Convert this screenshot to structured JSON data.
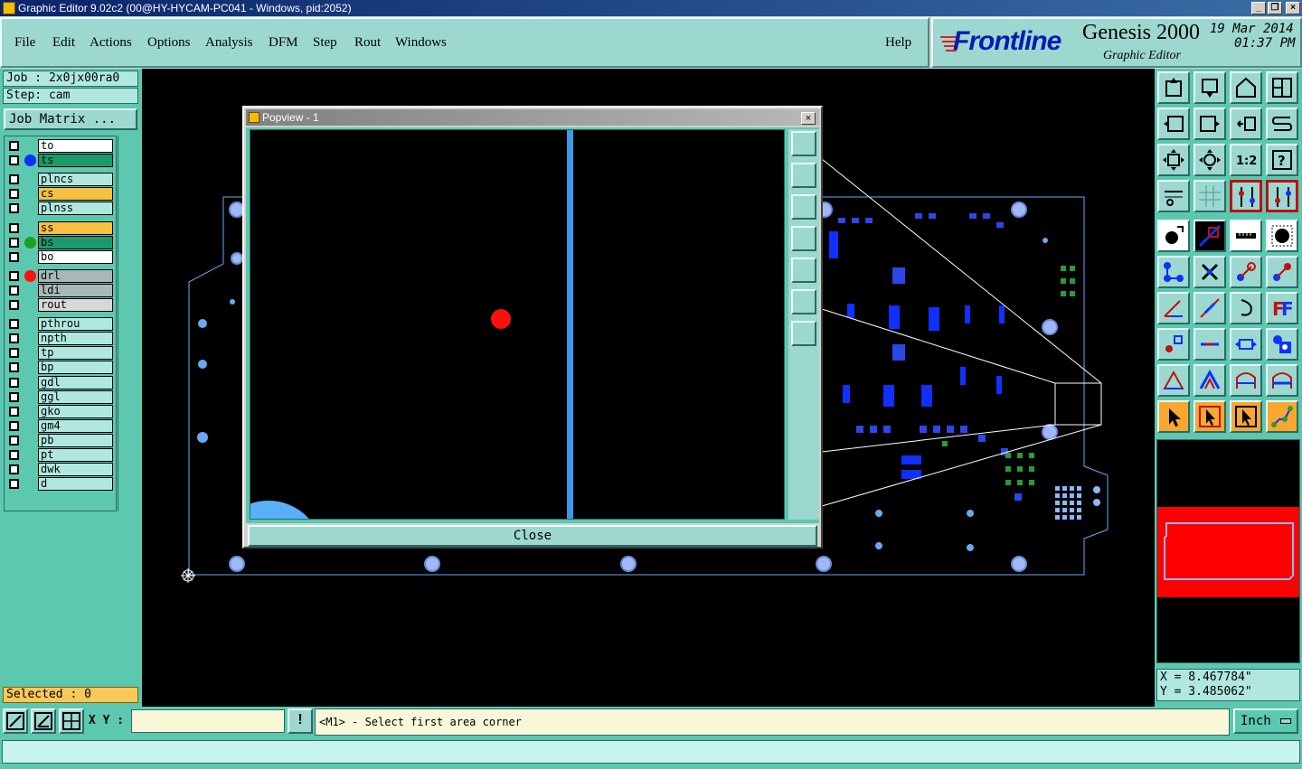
{
  "window": {
    "title": "Graphic Editor 9.02c2 (00@HY-HYCAM-PC041 - Windows, pid:2052)"
  },
  "menu": {
    "items": [
      "File",
      "Edit",
      "Actions",
      "Options",
      "Analysis",
      "DFM",
      "Step",
      "Rout",
      "Windows"
    ],
    "help": "Help"
  },
  "brand": {
    "logo": "Frontline",
    "product": "Genesis 2000",
    "subtitle": "Graphic Editor",
    "date": "19 Mar 2014",
    "time": "01:37 PM"
  },
  "job": {
    "job_line": "Job : 2x0jx00ra0",
    "step_line": "Step: cam",
    "matrix_button": "Job Matrix ..."
  },
  "layers": [
    {
      "name": "to",
      "color": "#ffffff",
      "dot": ""
    },
    {
      "name": "ts",
      "color": "#1a9a6a",
      "dot": "#1030ff"
    },
    {
      "name": "plncs",
      "color": "#b0e8e0",
      "dot": ""
    },
    {
      "name": "cs",
      "color": "#f8c040",
      "dot": ""
    },
    {
      "name": "plnss",
      "color": "#b0e8e0",
      "dot": ""
    },
    {
      "name": "ss",
      "color": "#f8c040",
      "dot": ""
    },
    {
      "name": "bs",
      "color": "#1a9a6a",
      "dot": "#20a020"
    },
    {
      "name": "bo",
      "color": "#ffffff",
      "dot": ""
    },
    {
      "name": "drl",
      "color": "#a8b8b8",
      "dot": "#ff1010"
    },
    {
      "name": "ldi",
      "color": "#a8b8b8",
      "dot": ""
    },
    {
      "name": "rout",
      "color": "#d8d8d8",
      "dot": ""
    },
    {
      "name": "pthrou",
      "color": "#b0e8e0",
      "dot": ""
    },
    {
      "name": "npth",
      "color": "#b0e8e0",
      "dot": ""
    },
    {
      "name": "tp",
      "color": "#b0e8e0",
      "dot": ""
    },
    {
      "name": "bp",
      "color": "#b0e8e0",
      "dot": ""
    },
    {
      "name": "gdl",
      "color": "#b0e8e0",
      "dot": ""
    },
    {
      "name": "ggl",
      "color": "#b0e8e0",
      "dot": ""
    },
    {
      "name": "gko",
      "color": "#b0e8e0",
      "dot": ""
    },
    {
      "name": "gm4",
      "color": "#b0e8e0",
      "dot": ""
    },
    {
      "name": "pb",
      "color": "#b0e8e0",
      "dot": ""
    },
    {
      "name": "pt",
      "color": "#b0e8e0",
      "dot": ""
    },
    {
      "name": "dwk",
      "color": "#b0e8e0",
      "dot": ""
    },
    {
      "name": "d",
      "color": "#b0e8e0",
      "dot": ""
    }
  ],
  "selected": "Selected : 0",
  "popview": {
    "title": "Popview - 1",
    "close_label": "Close"
  },
  "coords": {
    "x": "X = 8.467784\"",
    "y": "Y = 3.485062\""
  },
  "status": {
    "xy_label": "X Y :",
    "xy_value": "",
    "warn_glyph": "!",
    "prompt": "<M1> - Select first area corner",
    "units": "Inch"
  },
  "colors": {
    "panel": "#5cc8b0",
    "pad": "#8ab8f8",
    "copper": "#1030ff",
    "overview_fill": "#ff0000"
  }
}
